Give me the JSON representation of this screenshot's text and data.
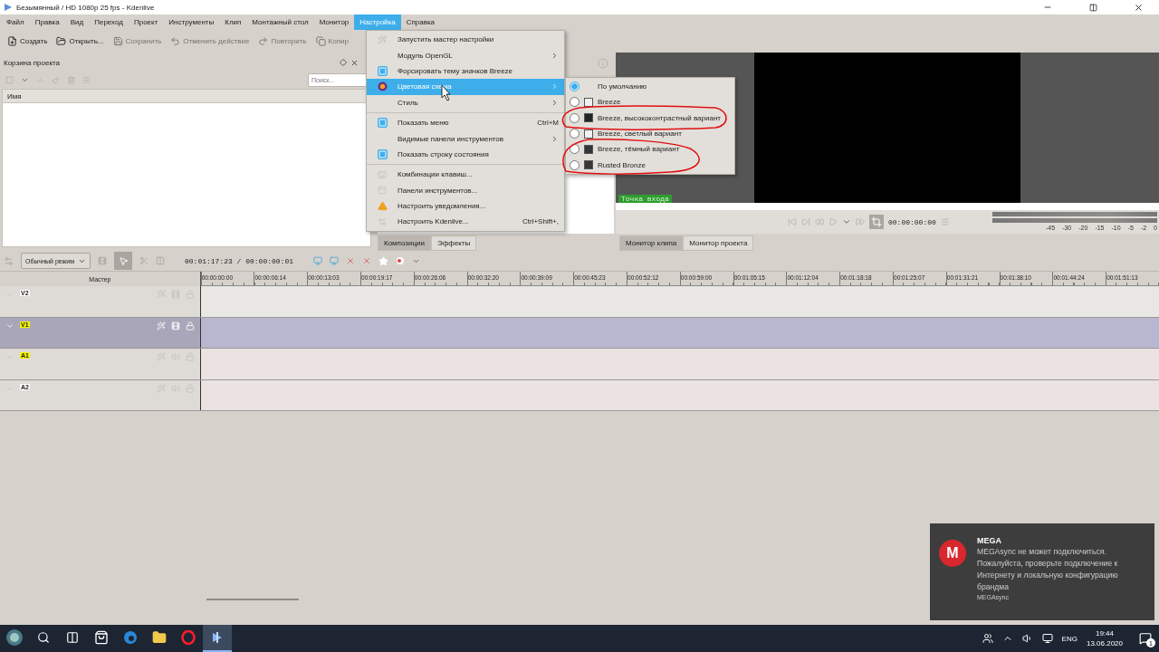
{
  "window": {
    "title": "Безымянный / HD 1080p 25 fps - Kdenlive"
  },
  "menubar": [
    {
      "label": "Файл",
      "selected": false
    },
    {
      "label": "Правка",
      "selected": false
    },
    {
      "label": "Вид",
      "selected": false
    },
    {
      "label": "Переход",
      "selected": false
    },
    {
      "label": "Проект",
      "selected": false
    },
    {
      "label": "Инструменты",
      "selected": false
    },
    {
      "label": "Клип",
      "selected": false
    },
    {
      "label": "Монтажный стол",
      "selected": false
    },
    {
      "label": "Монитор",
      "selected": false
    },
    {
      "label": "Настройка",
      "selected": true
    },
    {
      "label": "Справка",
      "selected": false
    }
  ],
  "toolbar": [
    {
      "label": "Создать",
      "disabled": false
    },
    {
      "label": "Открыть...",
      "disabled": false
    },
    {
      "label": "Сохранить",
      "disabled": true
    },
    {
      "label": "Отменить действие",
      "disabled": true
    },
    {
      "label": "Повторить",
      "disabled": true
    },
    {
      "label": "Копир",
      "disabled": true
    }
  ],
  "project_bin": {
    "title": "Корзина проекта",
    "search": {
      "placeholder": "Поиск..."
    },
    "column": "Имя"
  },
  "middle_tabs": [
    {
      "label": "Композиции",
      "selected": true
    },
    {
      "label": "Эффекты",
      "selected": false
    }
  ],
  "monitor": {
    "in_point": "Точка входа",
    "timecode": "00:00:00:00",
    "meter_scale": [
      "-45",
      "-30",
      "-20",
      "-15",
      "-10",
      "-5",
      "-2",
      "0"
    ],
    "tabs": [
      {
        "label": "Монитор клипа",
        "selected": true
      },
      {
        "label": "Монитор проекта",
        "selected": false
      }
    ]
  },
  "timeline": {
    "mode": "Обычный режим",
    "timecode": "00:01:17:23 / 00:00:00:01",
    "master": "Мастер",
    "ruler": [
      "00:00:00:00",
      "00:00:06:14",
      "00:00:13:03",
      "00:00:19:17",
      "00:00:26:06",
      "00:00:32:20",
      "00:00:39:09",
      "00:00:45:23",
      "00:00:52:12",
      "00:00:59:00",
      "00:01:05:15",
      "00:01:12:04",
      "00:01:18:18",
      "00:01:25:07",
      "00:01:31:21",
      "00:01:38:10",
      "00:01:44:24",
      "00:01:51:13"
    ],
    "tracks": [
      {
        "name": "V2",
        "kind": "video",
        "active": false,
        "selected": false
      },
      {
        "name": "V1",
        "kind": "video",
        "active": true,
        "selected": true
      },
      {
        "name": "A1",
        "kind": "audio",
        "active": true,
        "selected": false
      },
      {
        "name": "A2",
        "kind": "audio",
        "active": false,
        "selected": false
      }
    ]
  },
  "settings_menu": [
    {
      "kind": "action",
      "label": "Запустить мастер настройки",
      "selected": false
    },
    {
      "kind": "submenu",
      "label": "Модуль OpenGL",
      "selected": false
    },
    {
      "kind": "check",
      "label": "Форсировать тему значков Breeze",
      "checked": true,
      "selected": false
    },
    {
      "kind": "submenu",
      "label": "Цветовая схема",
      "selected": true
    },
    {
      "kind": "submenu",
      "label": "Стиль",
      "selected": false
    },
    {
      "kind": "separator"
    },
    {
      "kind": "check",
      "label": "Показать меню",
      "checked": true,
      "shortcut": "Ctrl+M",
      "selected": false
    },
    {
      "kind": "submenu",
      "label": "Видимые панели инструментов",
      "selected": false
    },
    {
      "kind": "check",
      "label": "Показать строку состояния",
      "checked": true,
      "selected": false
    },
    {
      "kind": "separator"
    },
    {
      "kind": "action",
      "label": "Комбинации клавиш...",
      "selected": false
    },
    {
      "kind": "action",
      "label": "Панели инструментов...",
      "selected": false
    },
    {
      "kind": "action",
      "label": "Настроить уведомления...",
      "selected": false
    },
    {
      "kind": "action",
      "label": "Настроить Kdenlive...",
      "shortcut": "Ctrl+Shift+,",
      "selected": false
    }
  ],
  "color_scheme_menu": [
    {
      "label": "По умолчанию",
      "selected": true
    },
    {
      "label": "Breeze",
      "selected": false,
      "color": "#eff0f1"
    },
    {
      "label": "Breeze, высококонтрастный вариант",
      "selected": false,
      "color": "#232627"
    },
    {
      "label": "Breeze, светлый вариант",
      "selected": false,
      "color": "#eff0f1"
    },
    {
      "label": "Breeze, тёмный вариант",
      "selected": false,
      "color": "#31363b"
    },
    {
      "label": "Rusted Bronze",
      "selected": false,
      "color": "#3a3634"
    }
  ],
  "notification": {
    "logo": "M",
    "title": "MEGA",
    "message": "MEGAsync не может подключиться. Пожалуйста, проверьте подключение к Интернету и локальную конфигурацию брандма",
    "source": "MEGAsync"
  },
  "taskbar": {
    "apps": [
      {
        "kind": "store",
        "active": false
      },
      {
        "kind": "browser",
        "active": false
      },
      {
        "kind": "folder",
        "active": false
      },
      {
        "kind": "opera",
        "active": false
      },
      {
        "kind": "kdenlive",
        "active": true
      }
    ],
    "language": "ENG",
    "time": "19:44",
    "date": "13.06.2020",
    "badge": "1"
  }
}
